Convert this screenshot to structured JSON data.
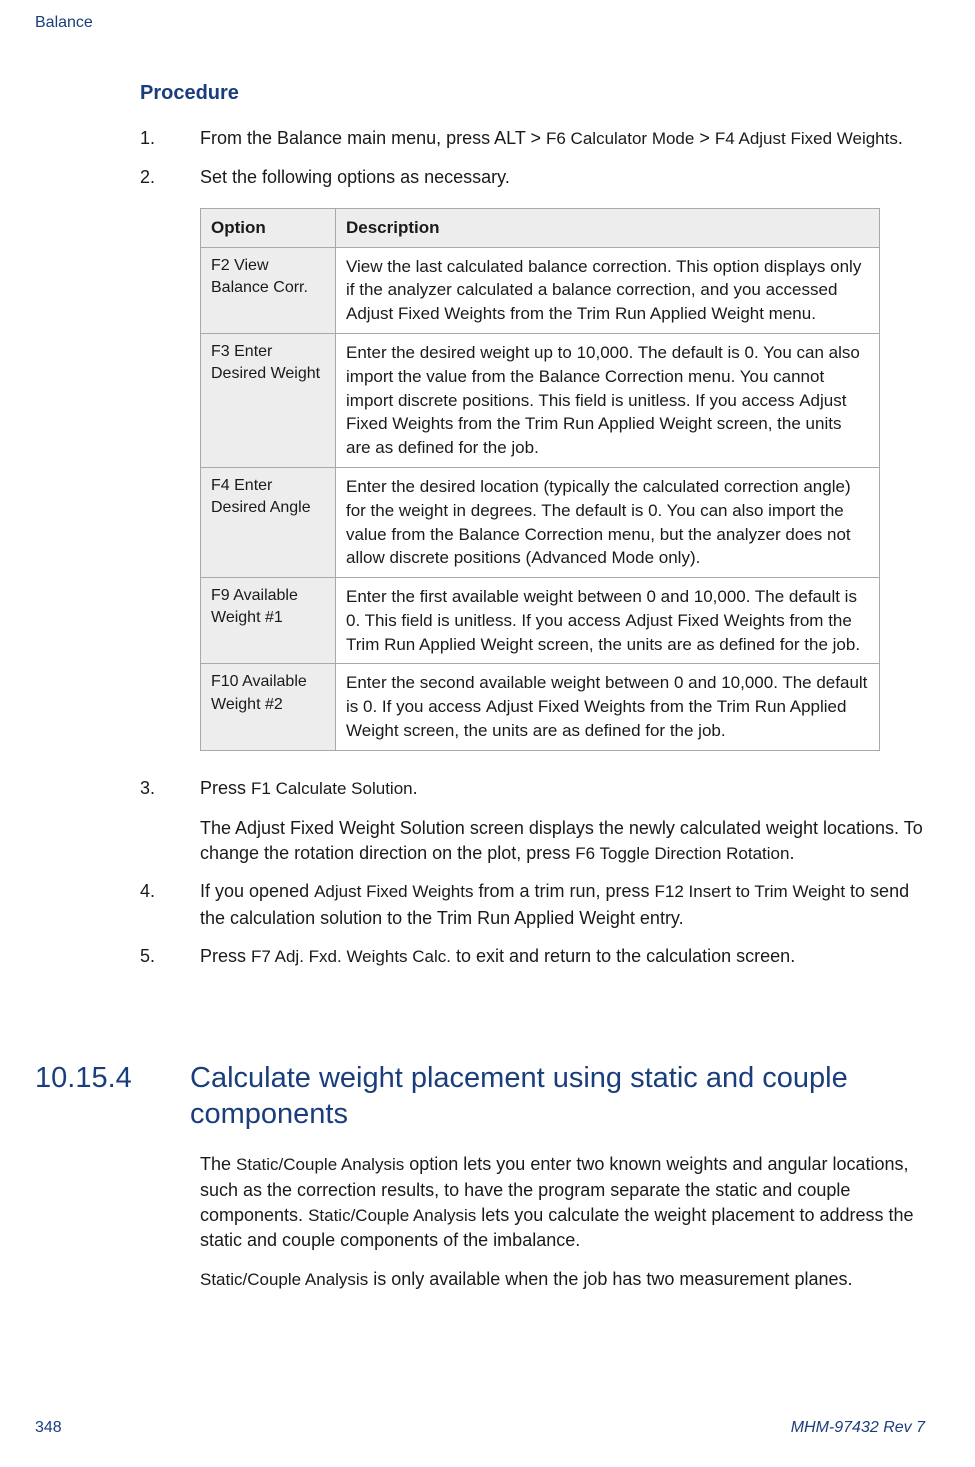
{
  "header": {
    "chapter": "Balance"
  },
  "procedure": {
    "heading": "Procedure",
    "steps": {
      "s1_pre": "From the Balance main menu, press ALT > ",
      "s1_code1": "F6 Calculator Mode",
      "s1_mid": " > ",
      "s1_code2": "F4 Adjust Fixed Weights",
      "s1_post": ".",
      "s2": "Set the following options as necessary.",
      "s3_pre": "Press ",
      "s3_code": "F1 Calculate Solution",
      "s3_post": ".",
      "s3_body_a": "The Adjust Fixed Weight Solution screen displays the newly calculated weight locations. To change the rotation direction on the plot, press ",
      "s3_body_code": "F6 Toggle Direction Rotation",
      "s3_body_b": ".",
      "s4_a": "If you opened ",
      "s4_code1": "Adjust Fixed Weights",
      "s4_b": " from a trim run, press ",
      "s4_code2": "F12 Insert to Trim Weight",
      "s4_c": " to send the calculation solution to the Trim Run Applied Weight entry.",
      "s5_a": "Press ",
      "s5_code": "F7 Adj. Fxd. Weights Calc.",
      "s5_b": " to exit and return to the calculation screen."
    },
    "table": {
      "h1": "Option",
      "h2": "Description",
      "r1_opt": "F2 View Balance Corr.",
      "r1_desc_a": "View the last calculated balance correction. This option displays only if the analyzer calculated a balance correction, and you accessed ",
      "r1_desc_code": "Adjust Fixed Weights",
      "r1_desc_b": " from the Trim Run Applied Weight menu.",
      "r2_opt": "F3 Enter Desired Weight",
      "r2_desc_a": "Enter the desired weight up to 10,000. The default is 0. You can also import the value from the Balance Correction menu. You cannot import discrete positions. This field is unitless. If you access ",
      "r2_desc_code": "Adjust Fixed Weights",
      "r2_desc_b": " from the Trim Run Applied Weight screen, the units are as defined for the job.",
      "r3_opt": "F4 Enter Desired Angle",
      "r3_desc": "Enter the desired location (typically the calculated correction angle) for the weight in degrees. The default is 0. You can also import the value from the Balance Correction menu, but the analyzer does not allow discrete positions (Advanced Mode only).",
      "r4_opt": "F9 Available Weight #1",
      "r4_desc_a": "Enter the first available weight between 0 and 10,000. The default is 0. This field is unitless. If you access ",
      "r4_desc_code": "Adjust Fixed Weights",
      "r4_desc_b": " from the Trim Run Applied Weight screen, the units are as defined for the job.",
      "r5_opt": "F10 Available Weight #2",
      "r5_desc_a": "Enter the second available weight between 0 and 10,000. The default is 0. If you access ",
      "r5_desc_code": "Adjust Fixed Weights",
      "r5_desc_b": " from the Trim Run Applied Weight screen, the units are as defined for the job."
    }
  },
  "section": {
    "num": "10.15.4",
    "title": "Calculate weight placement using static and couple components",
    "p1_a": "The ",
    "p1_code1": "Static/Couple Analysis",
    "p1_b": " option lets you enter two known weights and angular locations, such as the correction results, to have the program separate the static and couple components. ",
    "p1_code2": "Static/Couple Analysis",
    "p1_c": " lets you calculate the weight placement to address the static and couple components of the imbalance.",
    "p2_code": "Static/Couple Analysis",
    "p2_a": " is only available when the job has two measurement planes."
  },
  "footer": {
    "page": "348",
    "doc": "MHM-97432 Rev 7"
  }
}
